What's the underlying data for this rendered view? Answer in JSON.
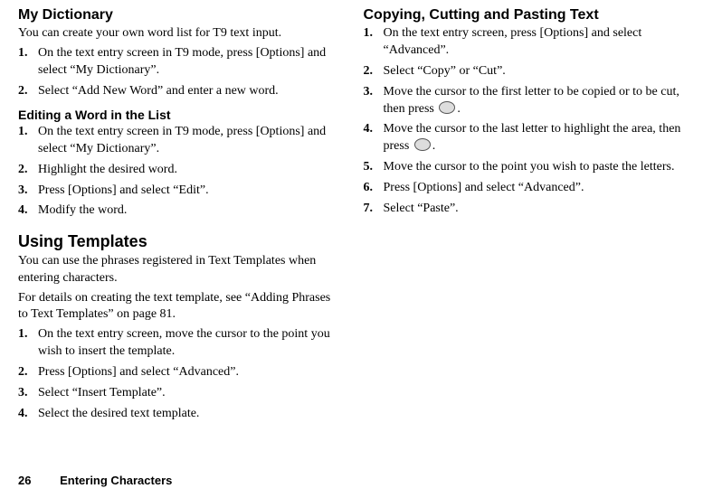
{
  "left": {
    "myDict": {
      "heading": "My Dictionary",
      "intro": "You can create your own word list for T9 text input.",
      "steps": [
        "On the text entry screen in T9 mode, press [Options] and select “My Dictionary”.",
        "Select “Add New Word” and enter a new word."
      ]
    },
    "editing": {
      "heading": "Editing a Word in the List",
      "steps": [
        "On the text entry screen in T9 mode, press [Options] and select “My Dictionary”.",
        "Highlight the desired word.",
        "Press [Options] and select “Edit”.",
        "Modify the word."
      ]
    },
    "templates": {
      "heading": "Using Templates",
      "intro1": "You can use the phrases registered in Text Templates when entering characters.",
      "intro2": "For details on creating the text template, see “Adding Phrases to Text Templates” on page 81.",
      "steps": [
        "On the text entry screen, move the cursor to the point you wish to insert the template.",
        "Press [Options] and select “Advanced”.",
        "Select “Insert Template”.",
        "Select the desired text template."
      ]
    }
  },
  "right": {
    "copyCut": {
      "heading": "Copying, Cutting and Pasting Text",
      "steps": [
        {
          "text": "On the text entry screen, press [Options] and select “Advanced”."
        },
        {
          "text": "Select “Copy” or “Cut”."
        },
        {
          "pre": "Move the cursor to the first letter to be copied or to be cut, then press ",
          "post": "."
        },
        {
          "pre": "Move the cursor to the last letter to highlight the area, then press ",
          "post": "."
        },
        {
          "text": "Move the cursor to the point you wish to paste the letters."
        },
        {
          "text": "Press [Options] and select “Advanced”."
        },
        {
          "text": "Select “Paste”."
        }
      ]
    }
  },
  "footer": {
    "page": "26",
    "section": "Entering Characters"
  }
}
